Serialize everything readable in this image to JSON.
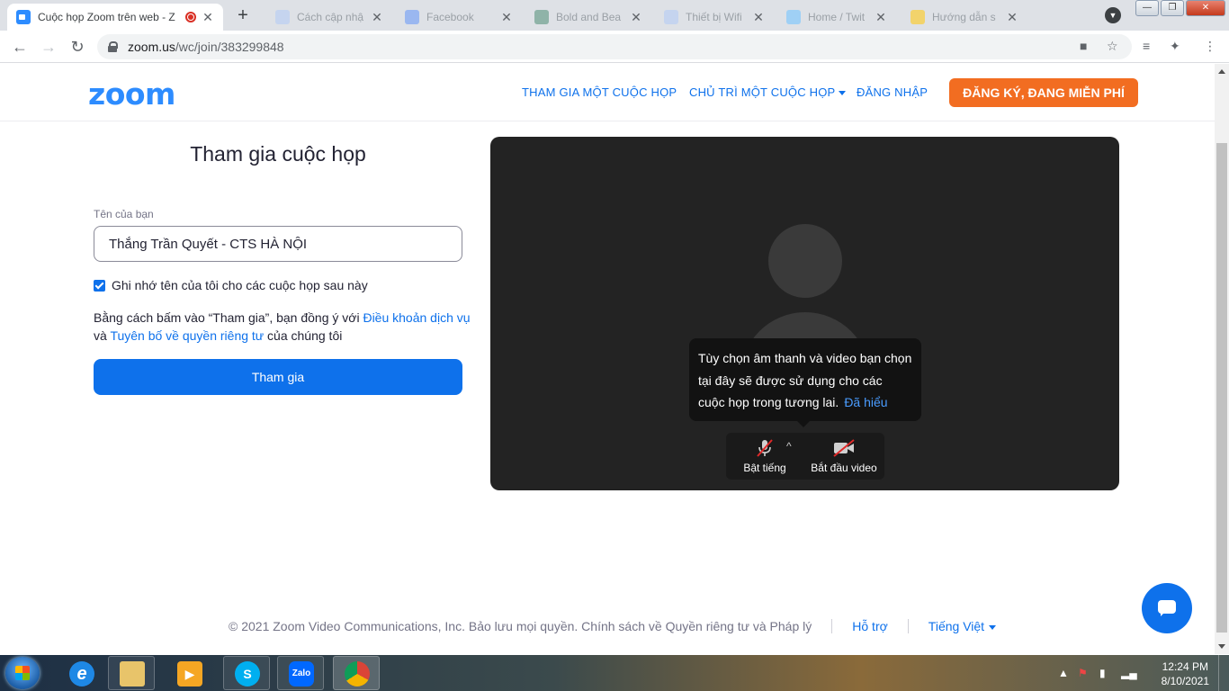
{
  "browser": {
    "active_tab": {
      "title": "Cuộc họp Zoom trên web - Z"
    },
    "background_tabs": [
      {
        "title": "Cách cập nhậ"
      },
      {
        "title": "Facebook"
      },
      {
        "title": "Bold and Bea"
      },
      {
        "title": "Thiết bị Wifi"
      },
      {
        "title": "Home / Twit"
      },
      {
        "title": "Hướng dẫn s"
      }
    ],
    "new_tab_label": "+",
    "url_host": "zoom.us",
    "url_path": "/wc/join/383299848"
  },
  "header": {
    "logo": "zoom",
    "nav": {
      "join": "THAM GIA MỘT CUỘC HỌP",
      "host": "CHỦ TRÌ MỘT CUỘC HỌP",
      "signin": "ĐĂNG NHẬP"
    },
    "signup": "ĐĂNG KÝ, ĐANG MIỄN PHÍ"
  },
  "form": {
    "title": "Tham gia cuộc họp",
    "name_label": "Tên của bạn",
    "name_value": "Thắng Trần Quyết - CTS HÀ NỘI",
    "remember_label": "Ghi nhớ tên của tôi cho các cuộc họp sau này",
    "terms_prefix": "Bằng cách bấm vào “Tham gia”, bạn đồng ý với ",
    "terms_link": "Điều khoản dịch vụ",
    "terms_and": " và ",
    "privacy_link": "Tuyên bố về quyền riêng tư",
    "terms_suffix": " của chúng tôi",
    "join_button": "Tham gia"
  },
  "preview": {
    "tooltip_text": "Tùy chọn âm thanh và video bạn chọn tại đây sẽ được sử dụng cho các cuộc họp trong tương lai.",
    "tooltip_link": "Đã hiểu",
    "mic_label": "Bật tiếng",
    "video_label": "Bắt đầu video"
  },
  "footer": {
    "copyright": "© 2021 Zoom Video Communications, Inc. Bảo lưu mọi quyền. Chính sách về Quyền riêng tư và Pháp lý",
    "support": "Hỗ trợ",
    "language": "Tiếng Việt"
  },
  "taskbar": {
    "apps": [
      "internet-explorer",
      "file-explorer",
      "media-player",
      "skype",
      "zalo",
      "chrome"
    ],
    "zalo_label": "Zalo",
    "skype_label": "S",
    "time": "12:24 PM",
    "date": "8/10/2021"
  },
  "colors": {
    "zoom_blue": "#0e71eb",
    "logo_blue": "#2d8cff",
    "signup_orange": "#f26d21",
    "preview_bg": "#232323"
  },
  "icons": {
    "lock": "lock-icon",
    "camera": "camera-icon",
    "star": "bookmark-star-icon",
    "mic": "mic-muted-icon",
    "video": "video-off-icon",
    "chat": "chat-icon"
  }
}
